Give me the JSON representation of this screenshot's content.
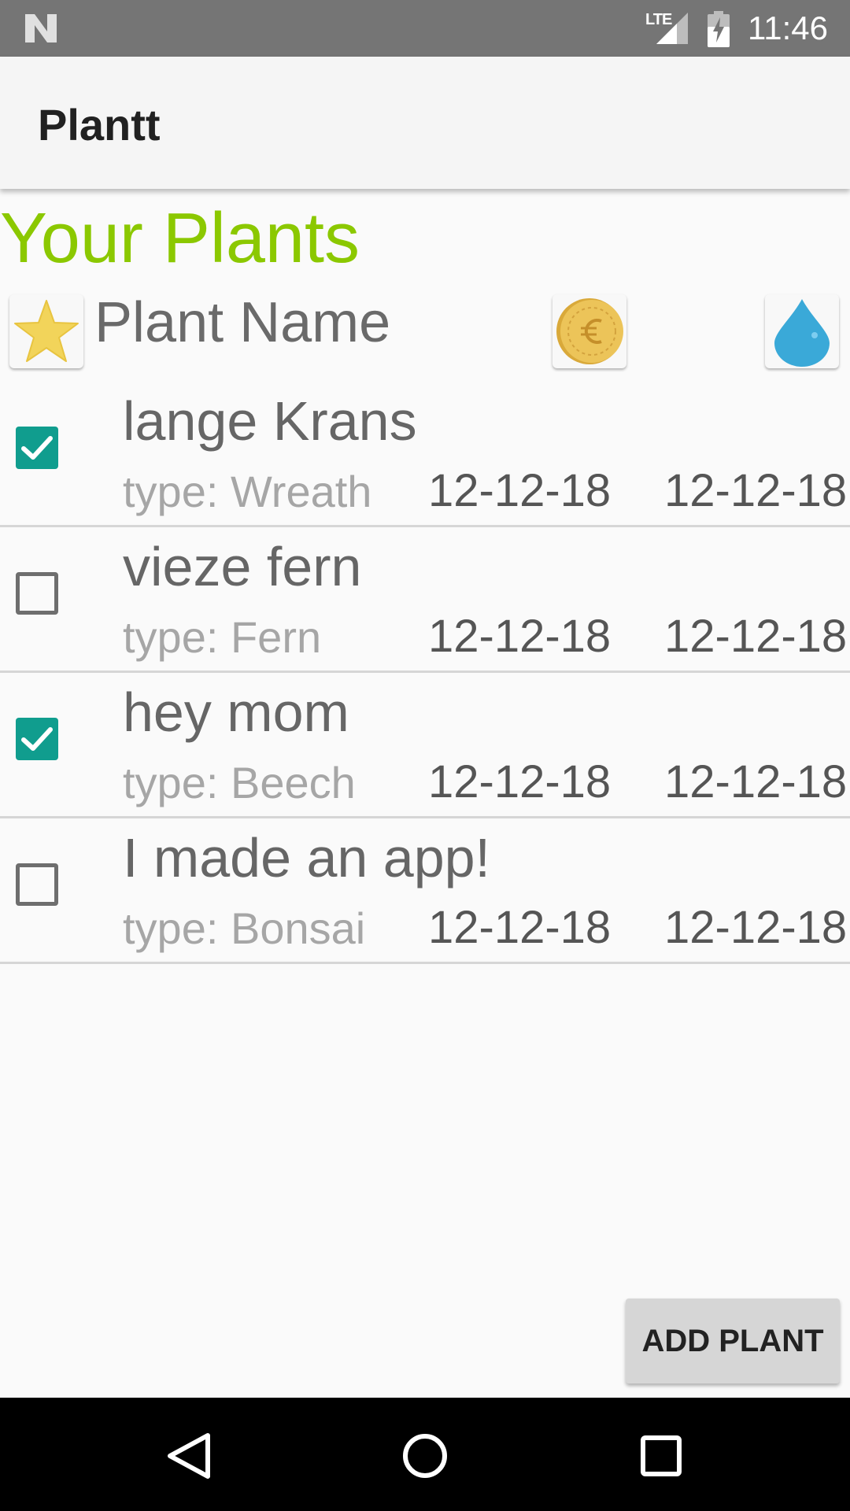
{
  "status_bar": {
    "network": "LTE",
    "time": "11:46"
  },
  "app_bar": {
    "title": "Plantt"
  },
  "section": {
    "title": "Your Plants"
  },
  "header": {
    "favorite_icon": "star-icon",
    "name_label": "Plant Name",
    "cost_icon": "euro-coin-icon",
    "water_icon": "water-drop-icon"
  },
  "plants": [
    {
      "name": "lange Krans",
      "type": "type: Wreath",
      "date1": "12-12-18",
      "date2": "12-12-18",
      "checked": true
    },
    {
      "name": "vieze fern",
      "type": "type: Fern",
      "date1": "12-12-18",
      "date2": "12-12-18",
      "checked": false
    },
    {
      "name": "hey mom",
      "type": "type: Beech",
      "date1": "12-12-18",
      "date2": "12-12-18",
      "checked": true
    },
    {
      "name": "I made an app!",
      "type": "type: Bonsai",
      "date1": "12-12-18",
      "date2": "12-12-18",
      "checked": false
    }
  ],
  "add_button": {
    "label": "ADD PLANT"
  },
  "colors": {
    "accent": "#8bc800",
    "checkbox": "#109d8e",
    "status_bar": "#757575"
  }
}
